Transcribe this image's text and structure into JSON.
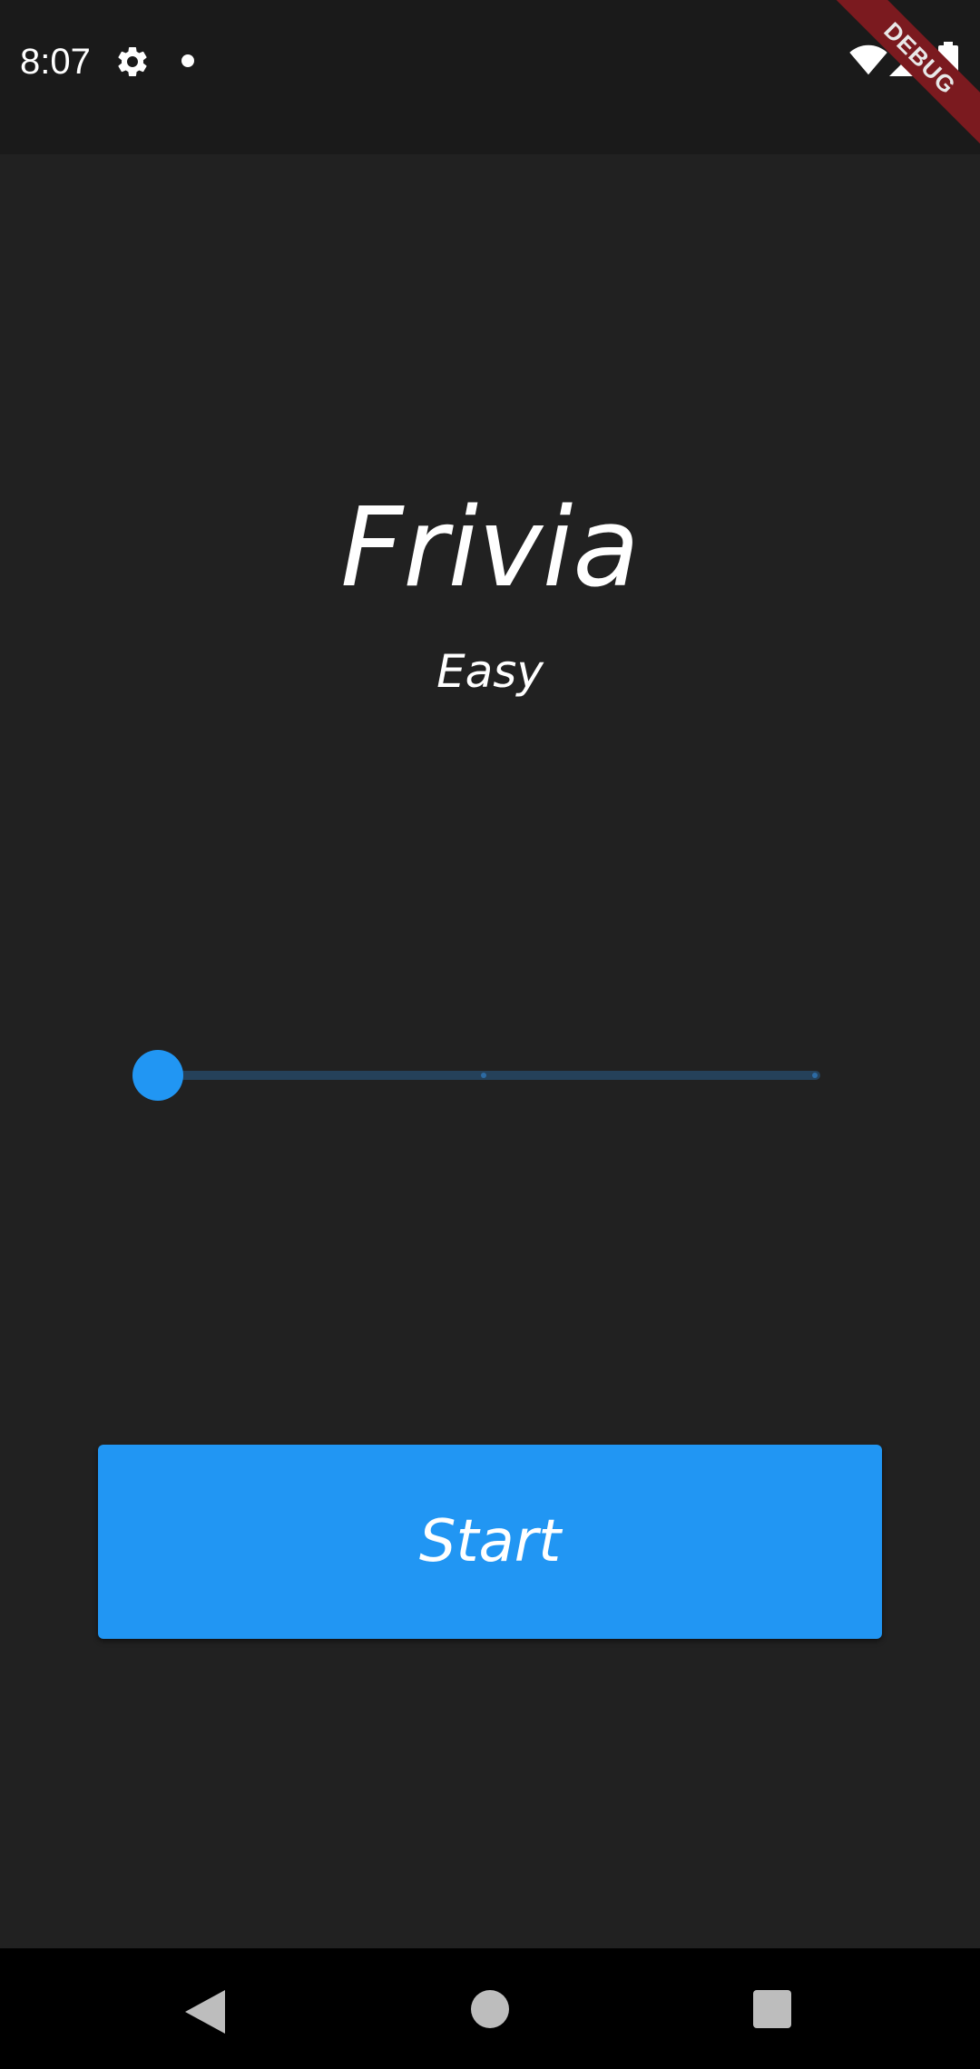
{
  "status_bar": {
    "time": "8:07",
    "icons": [
      "gear-icon",
      "notification-dot-icon",
      "wifi-icon",
      "cell-signal-icon",
      "battery-icon"
    ]
  },
  "debug_banner": {
    "label": "DEBUG",
    "color": "#7b1a1f"
  },
  "main": {
    "title": "Frivia",
    "difficulty_label": "Easy",
    "slider": {
      "min": 0,
      "max": 2,
      "value": 0,
      "divisions": 2
    },
    "start_label": "Start"
  },
  "nav_bar": {
    "icons": [
      "back-icon",
      "home-icon",
      "recents-icon"
    ]
  },
  "colors": {
    "background": "#212121",
    "status_bar": "#1a1a1a",
    "accent": "#2196f3",
    "slider_track": "#25415a",
    "text": "#ffffff",
    "nav_bar": "#000000"
  }
}
